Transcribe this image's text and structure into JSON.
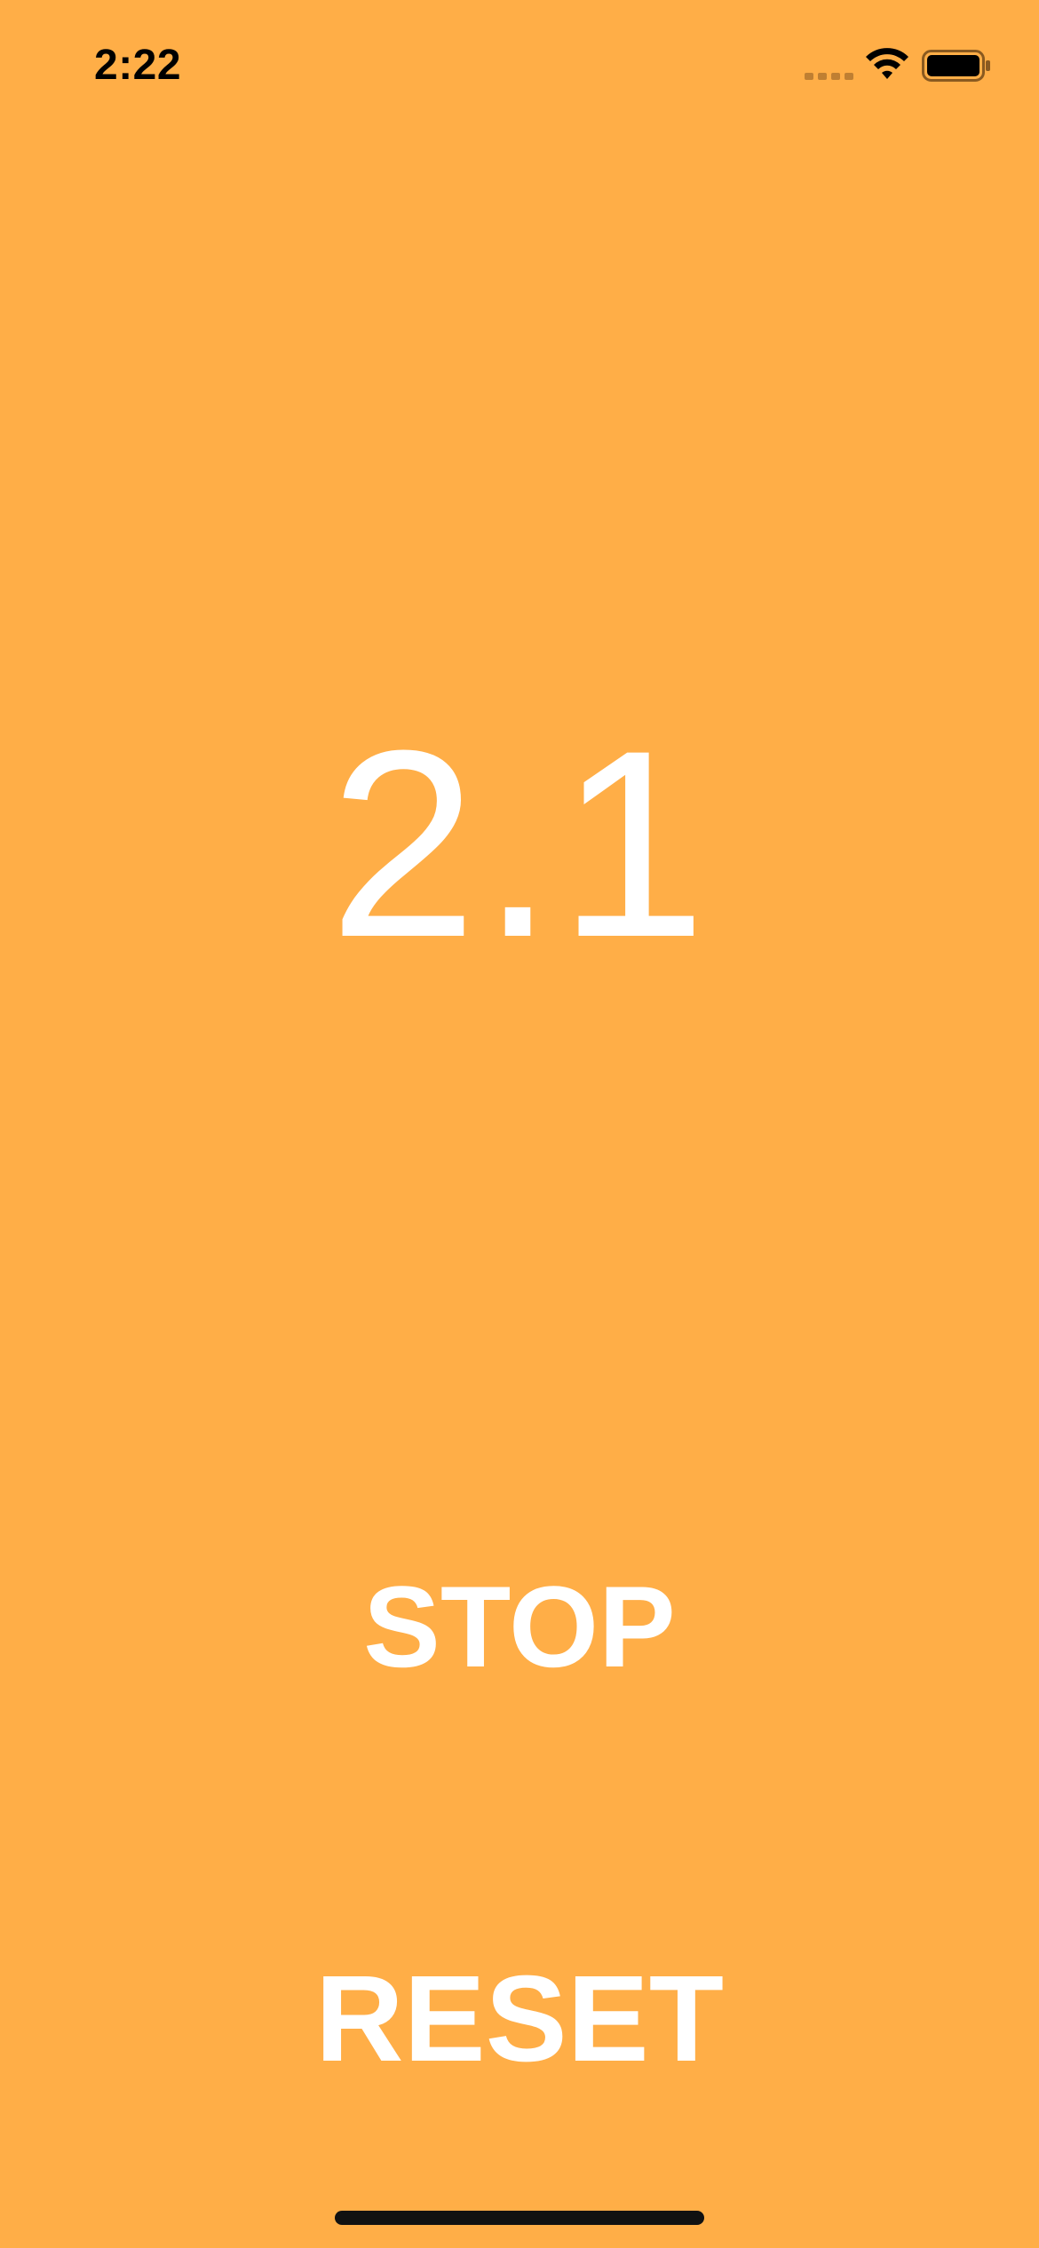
{
  "status_bar": {
    "time": "2:22",
    "signal_icon": "cellular-signal-icon",
    "wifi_icon": "wifi-icon",
    "battery_icon": "battery-icon"
  },
  "timer": {
    "value": "2.1"
  },
  "controls": {
    "stop_label": "STOP",
    "reset_label": "RESET"
  },
  "colors": {
    "background": "#FFAE47",
    "text": "#FFFFFF"
  }
}
